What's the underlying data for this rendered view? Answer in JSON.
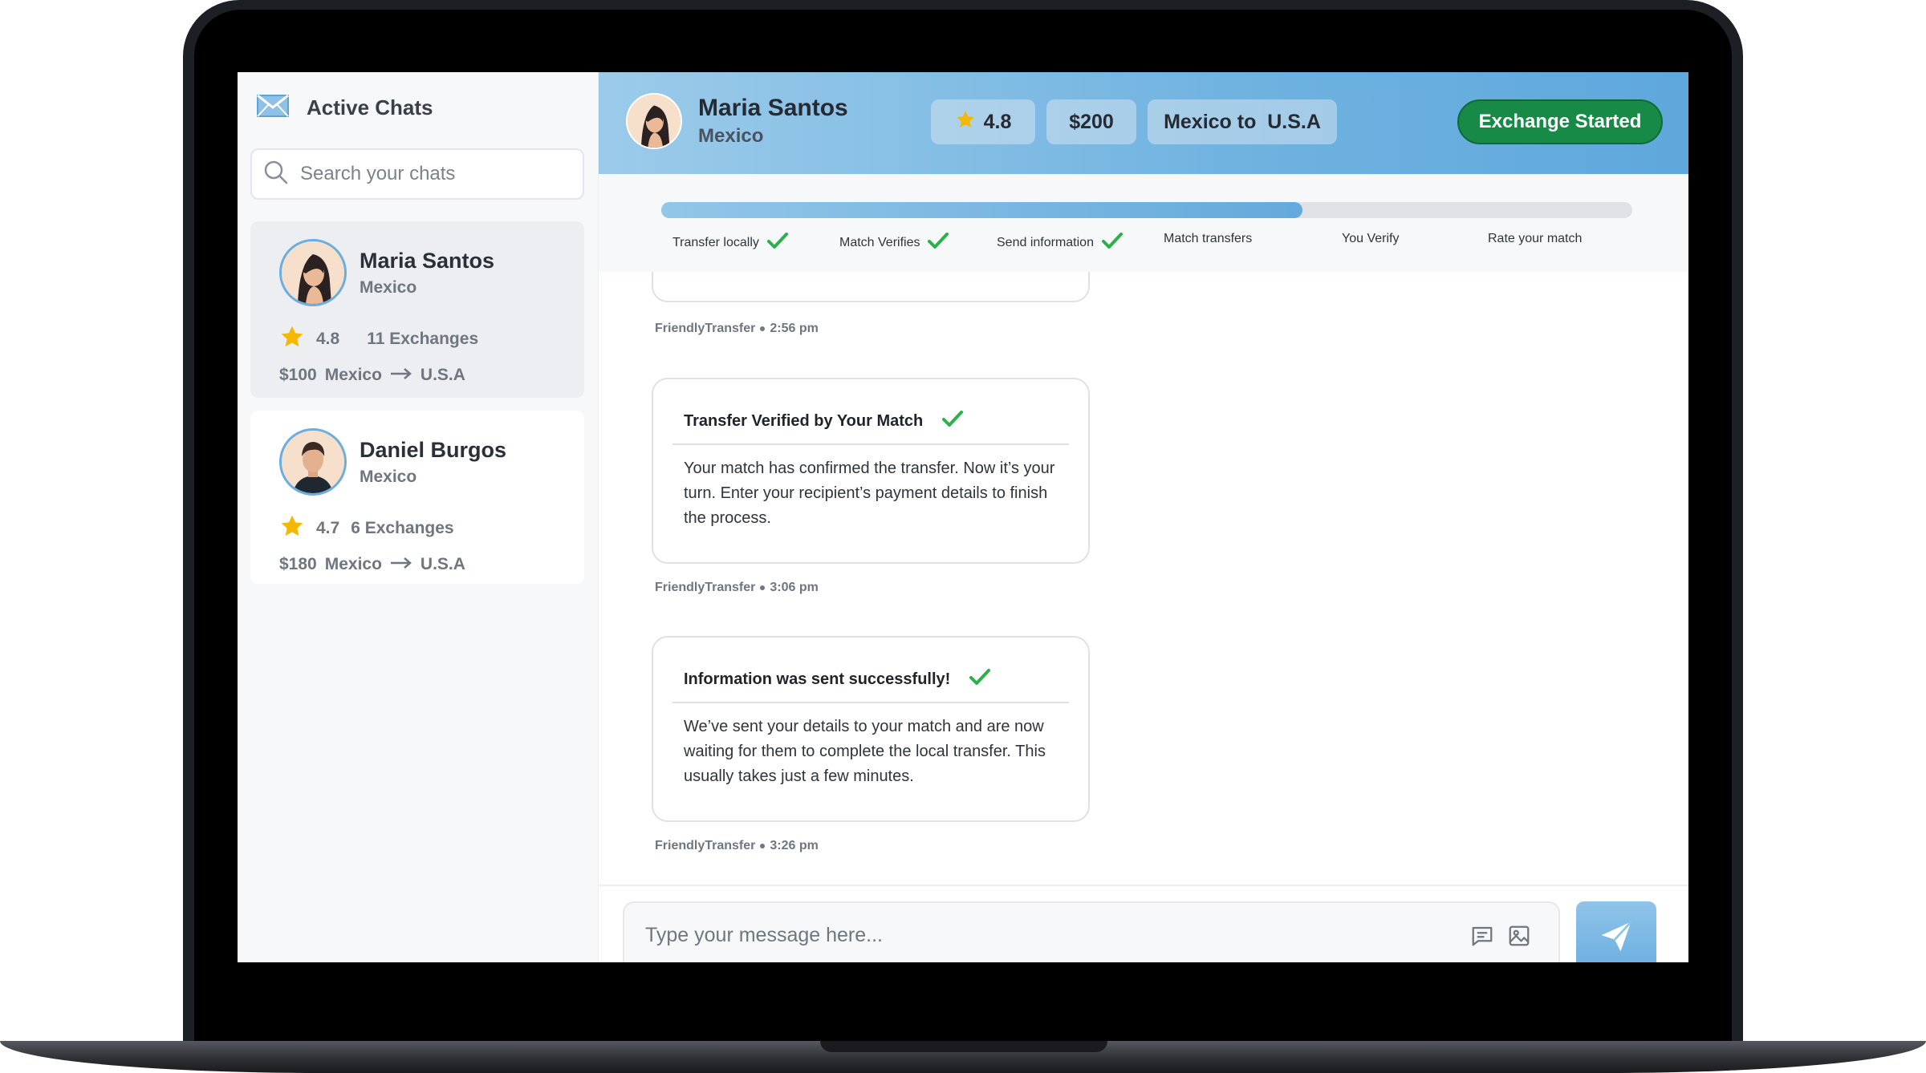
{
  "sidebar": {
    "title": "Active Chats",
    "search_placeholder": "Search your chats",
    "chats": [
      {
        "name": "Maria Santos",
        "country": "Mexico",
        "rating": "4.8",
        "exchanges": "11 Exchanges",
        "amount": "$100",
        "from": "Mexico",
        "to": "U.S.A"
      },
      {
        "name": "Daniel Burgos",
        "country": "Mexico",
        "rating": "4.7",
        "exchanges": "6 Exchanges",
        "amount": "$180",
        "from": "Mexico",
        "to": "U.S.A"
      }
    ]
  },
  "header": {
    "name": "Maria Santos",
    "country": "Mexico",
    "rating": "4.8",
    "amount": "$200",
    "route": "Mexico to  U.S.A",
    "status_button": "Exchange Started"
  },
  "progress": {
    "fraction": 0.66,
    "steps": [
      {
        "label": "Transfer locally",
        "done": true
      },
      {
        "label": "Match Verifies",
        "done": true
      },
      {
        "label": "Send information",
        "done": true
      },
      {
        "label": "Match transfers",
        "done": false
      },
      {
        "label": "You Verify",
        "done": false
      },
      {
        "label": "Rate your match",
        "done": false
      }
    ]
  },
  "messages": [
    {
      "sender": "FriendlyTransfer",
      "time": "2:56 pm"
    },
    {
      "title": "Transfer Verified by Your Match",
      "body": "Your match has confirmed the transfer. Now it’s your turn. Enter your recipient’s payment details to finish the process.",
      "sender": "FriendlyTransfer",
      "time": "3:06 pm"
    },
    {
      "title": "Information was sent successfully!",
      "body": "We’ve sent your details to your match and are now waiting for them to complete the local transfer. This usually takes just a few minutes.",
      "sender": "FriendlyTransfer",
      "time": "3:26 pm"
    }
  ],
  "composer": {
    "placeholder": "Type your message here..."
  },
  "colors": {
    "accent": "#6aaee0",
    "success": "#188a48",
    "check": "#2bb04a",
    "star": "#f5b800"
  }
}
